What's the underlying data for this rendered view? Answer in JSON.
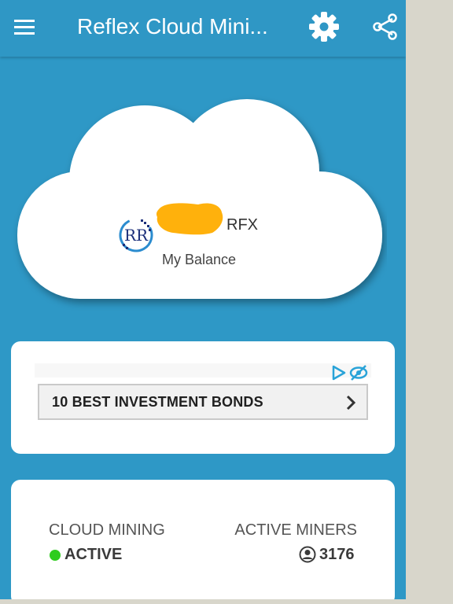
{
  "appbar": {
    "title": "Reflex Cloud Mini...",
    "menu_icon": "hamburger-menu-icon",
    "settings_icon": "gear-icon",
    "share_icon": "share-icon"
  },
  "balance": {
    "unit": "RFX",
    "label": "My Balance",
    "logo_icon": "rfx-logo"
  },
  "ad": {
    "button_text": "10 BEST INVESTMENT BONDS",
    "adchoices_icon": "adchoices-icon",
    "hide_icon": "hide-ad-icon",
    "chevron_icon": "chevron-right-icon"
  },
  "status": {
    "cloud_mining_label": "CLOUD MINING",
    "cloud_mining_value": "ACTIVE",
    "active_miners_label": "ACTIVE MINERS",
    "active_miners_value": "3176"
  },
  "colors": {
    "primary": "#2e98c6",
    "active": "#2ecc1e",
    "ad_icons": "#29a3d8"
  }
}
